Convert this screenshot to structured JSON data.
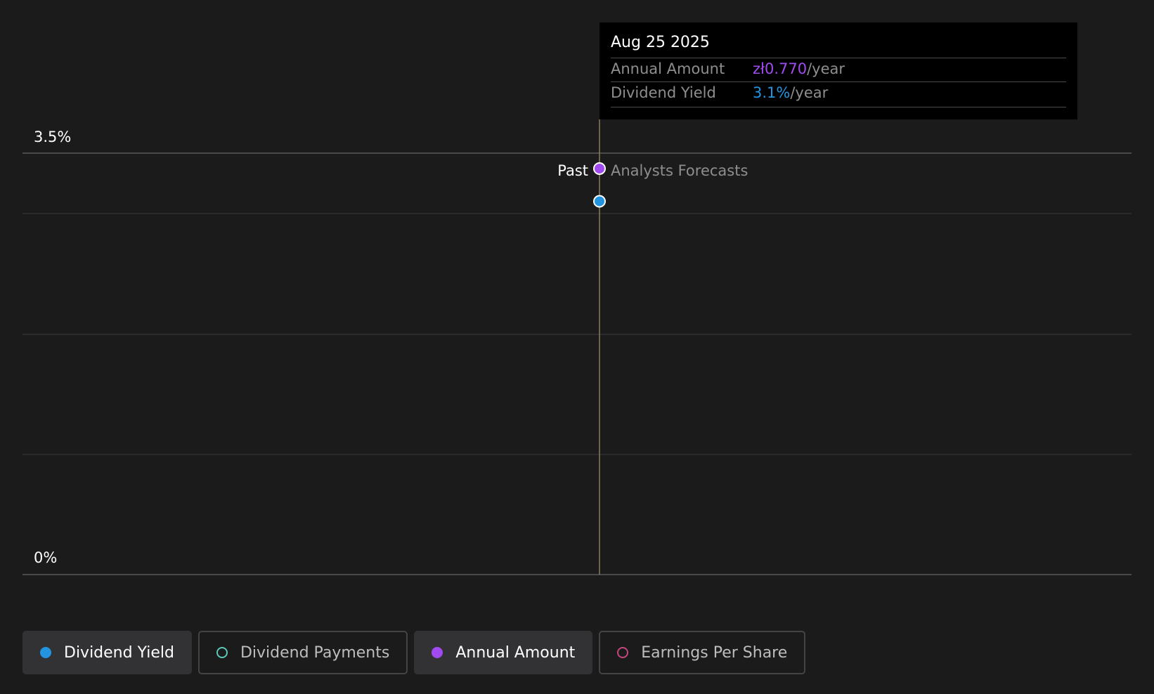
{
  "chart_data": {
    "type": "scatter",
    "ylim": [
      0,
      3.5
    ],
    "y_tick_labels": [
      "3.5%",
      "0%"
    ],
    "grid": true,
    "divider": {
      "date": "Aug 25 2025",
      "past_label": "Past",
      "future_label": "Analysts Forecasts"
    },
    "series": [
      {
        "name": "Dividend Yield",
        "color": "#2394df",
        "x": [
          "Aug 25 2025"
        ],
        "values": [
          3.1
        ]
      },
      {
        "name": "Annual Amount",
        "color": "#a04af0",
        "x": [
          "Aug 25 2025"
        ],
        "values": [
          0.77
        ]
      }
    ]
  },
  "tooltip": {
    "date": "Aug 25 2025",
    "rows": [
      {
        "label": "Annual Amount",
        "value": "zł0.770",
        "unit": "/year",
        "color": "#a04af0"
      },
      {
        "label": "Dividend Yield",
        "value": "3.1%",
        "unit": "/year",
        "color": "#2394df"
      }
    ]
  },
  "legend": [
    {
      "label": "Dividend Yield",
      "color": "#2394df",
      "active": true
    },
    {
      "label": "Dividend Payments",
      "color": "#5ec8b8",
      "active": false
    },
    {
      "label": "Annual Amount",
      "color": "#a04af0",
      "active": true
    },
    {
      "label": "Earnings Per Share",
      "color": "#c2477e",
      "active": false
    }
  ]
}
